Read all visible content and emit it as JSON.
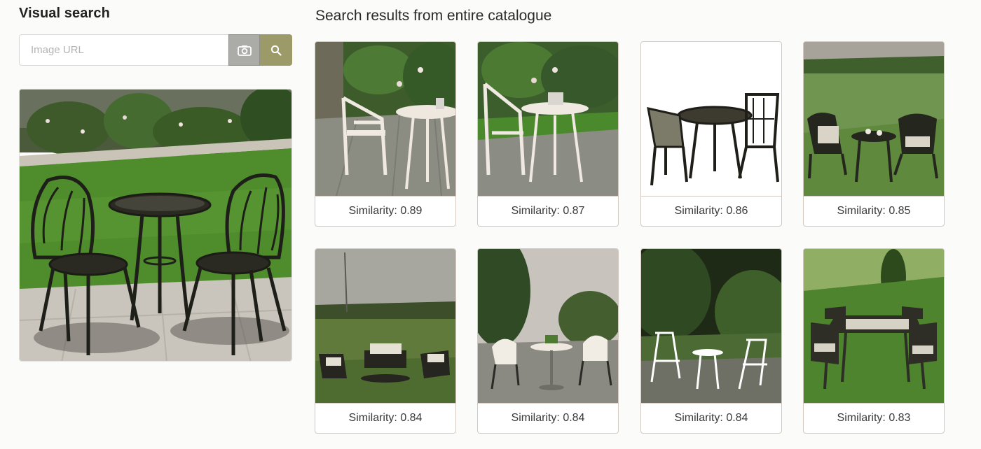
{
  "sidebar": {
    "title": "Visual search",
    "search": {
      "placeholder": "Image URL",
      "value": "",
      "camera_icon": "camera-icon",
      "search_icon": "search-icon"
    },
    "query_image": "garden bistro set"
  },
  "results": {
    "title": "Search results from entire catalogue",
    "items": [
      {
        "caption": "Similarity: 0.89"
      },
      {
        "caption": "Similarity: 0.87"
      },
      {
        "caption": "Similarity: 0.86"
      },
      {
        "caption": "Similarity: 0.85"
      },
      {
        "caption": "Similarity: 0.84"
      },
      {
        "caption": "Similarity: 0.84"
      },
      {
        "caption": "Similarity: 0.84"
      },
      {
        "caption": "Similarity: 0.83"
      }
    ]
  },
  "colors": {
    "search_button": "#9c9a68",
    "camera_button": "#ababa8",
    "card_border": "#d3c8c0"
  }
}
